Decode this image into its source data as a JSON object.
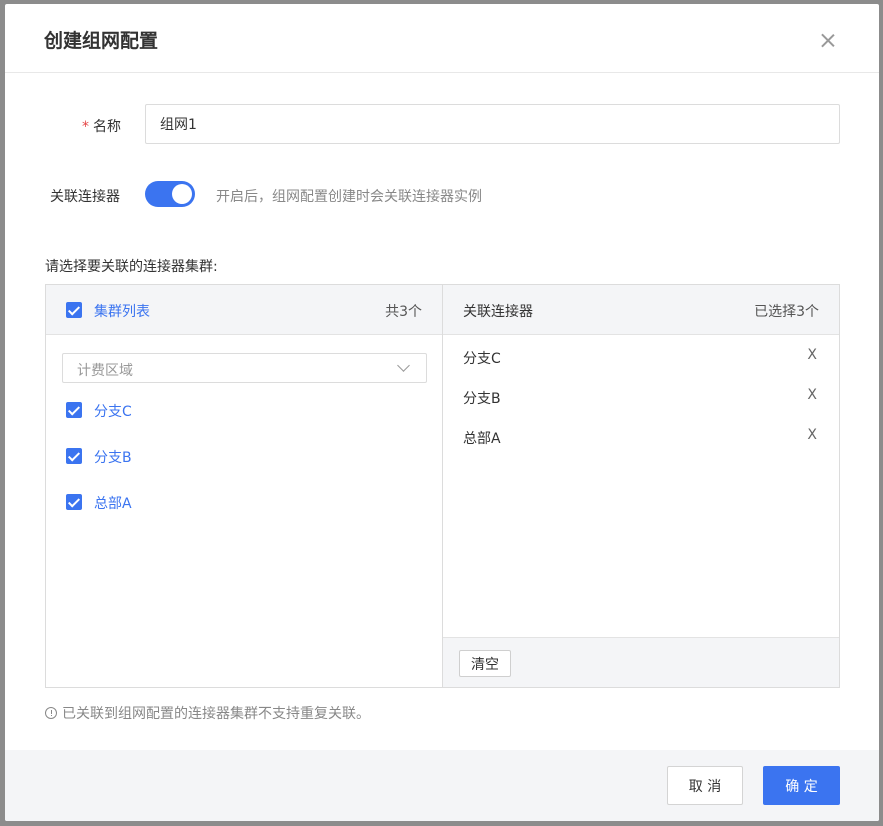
{
  "dialog": {
    "title": "创建组网配置",
    "close_icon": "close-icon"
  },
  "form": {
    "name_required_mark": "*",
    "name_label": "名称",
    "name_value": "组网1",
    "connector_label": "关联连接器",
    "connector_enabled": true,
    "connector_hint": "开启后，组网配置创建时会关联连接器实例",
    "select_prompt": "请选择要关联的连接器集群:"
  },
  "transfer": {
    "left": {
      "title": "集群列表",
      "count": "共3个",
      "filter_placeholder": "计费区域",
      "items": [
        {
          "label": "分支C",
          "checked": true
        },
        {
          "label": "分支B",
          "checked": true
        },
        {
          "label": "总部A",
          "checked": true
        }
      ]
    },
    "right": {
      "title": "关联连接器",
      "count": "已选择3个",
      "remove_glyph": "X",
      "items": [
        {
          "label": "分支C"
        },
        {
          "label": "分支B"
        },
        {
          "label": "总部A"
        }
      ],
      "clear_label": "清空"
    }
  },
  "notice": "已关联到组网配置的连接器集群不支持重复关联。",
  "footer": {
    "cancel_label": "取 消",
    "ok_label": "确 定"
  },
  "colors": {
    "primary": "#3b74f0",
    "required": "#e54545"
  }
}
